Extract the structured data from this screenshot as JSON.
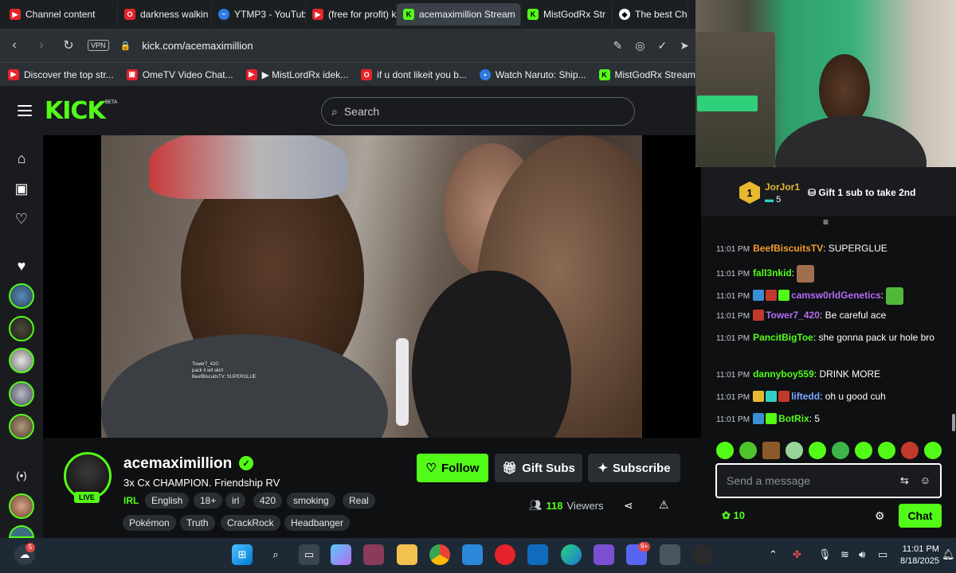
{
  "browser": {
    "tabs": [
      {
        "label": "Channel content",
        "icon": "youtube-icon",
        "active": false
      },
      {
        "label": "darkness walkin p",
        "icon": "opera-red-icon",
        "active": false
      },
      {
        "label": "YTMP3 - YouTube",
        "icon": "ytmp3-icon",
        "active": false
      },
      {
        "label": "(free for profit) ki",
        "icon": "youtube-icon",
        "active": false
      },
      {
        "label": "acemaximillion Stream",
        "icon": "kick-icon",
        "active": true
      },
      {
        "label": "MistGodRx Str",
        "icon": "kick-icon",
        "active": false
      },
      {
        "label": "The best ChatBo",
        "icon": "chatbot-icon",
        "active": false
      }
    ],
    "address": "kick.com/acemaximillion",
    "vpn_label": "VPN",
    "bookmarks": [
      {
        "label": "Discover the top str...",
        "icon": "youtube-icon"
      },
      {
        "label": "OmeTV Video Chat...",
        "icon": "ometv-icon"
      },
      {
        "label": "▶ MistLordRx idek...",
        "icon": "youtube-icon"
      },
      {
        "label": "if u dont likeit you b...",
        "icon": "opera-red-icon"
      },
      {
        "label": "Watch Naruto: Ship...",
        "icon": "crunchyroll-icon"
      },
      {
        "label": "MistGodRx Stream -...",
        "icon": "kick-icon"
      }
    ]
  },
  "kick": {
    "logo": "KICK",
    "beta": "BETA",
    "search_placeholder": "Search"
  },
  "stream": {
    "streamer": "acemaximillion",
    "live_label": "LIVE",
    "title": "3x Cx CHAMPION. Friendship RV",
    "category": "IRL",
    "tags": [
      "English",
      "18+",
      "irl",
      "420",
      "smoking",
      "Real",
      "Pokémon",
      "Truth",
      "CrackRock",
      "Headbanger"
    ],
    "follow_label": "Follow",
    "gift_label": "Gift Subs",
    "subscribe_label": "Subscribe",
    "viewer_count": "118",
    "viewers_label": "Viewers",
    "overlay_chat": [
      "Tower7_420:",
      "pack it wit skirt",
      "BeefBiscuitsTV: SUPERGLUE"
    ]
  },
  "chat": {
    "pinned": {
      "rank": "1",
      "user": "JorJor1",
      "count": "5",
      "cta": "Gift 1 sub to take 2nd"
    },
    "messages": [
      {
        "time": "11:01 PM",
        "user": "BeefBiscuitsTV",
        "color": "#f59b2f",
        "text": "SUPERGLUE",
        "badges": [],
        "emote": ""
      },
      {
        "time": "11:01 PM",
        "user": "fall3nkid",
        "color": "#53fc18",
        "text": "",
        "badges": [],
        "emote": "face"
      },
      {
        "time": "11:01 PM",
        "user": "camsw0rldGenetics",
        "color": "#b46cf2",
        "text": "",
        "badges": [
          "#3a8fd6",
          "#c0392b",
          "#53fc18"
        ],
        "emote": "frog"
      },
      {
        "time": "11:01 PM",
        "user": "Tower7_420",
        "color": "#b46cf2",
        "text": "Be careful ace",
        "badges": [
          "#c0392b"
        ],
        "emote": ""
      },
      {
        "time": "11:01 PM",
        "user": "PancitBigToe",
        "color": "#53fc18",
        "text": "she gonna pack ur hole bro",
        "badges": [],
        "emote": ""
      },
      {
        "time": "11:01 PM",
        "user": "dannyboy559",
        "color": "#53fc18",
        "text": "DRINK MORE",
        "badges": [],
        "emote": ""
      },
      {
        "time": "11:01 PM",
        "user": "liftedd",
        "color": "#7aa7ff",
        "text": "oh u good cuh",
        "badges": [
          "#e8b830",
          "#2fd1c5",
          "#c0392b"
        ],
        "emote": ""
      },
      {
        "time": "11:01 PM",
        "user": "BotRix",
        "color": "#53fc18",
        "text": "5",
        "badges": [
          "#3a8fd6",
          "#53fc18"
        ],
        "emote": ""
      }
    ],
    "input_placeholder": "Send a message",
    "points": "10",
    "send_label": "Chat"
  },
  "taskbar": {
    "time": "11:01 PM",
    "date": "8/18/2025",
    "notification_badge": "5",
    "discord_badge": "9+"
  },
  "colors": {
    "kick_green": "#53fc18",
    "page_bg": "#0b0e0f",
    "panel_bg": "#191b1f"
  }
}
